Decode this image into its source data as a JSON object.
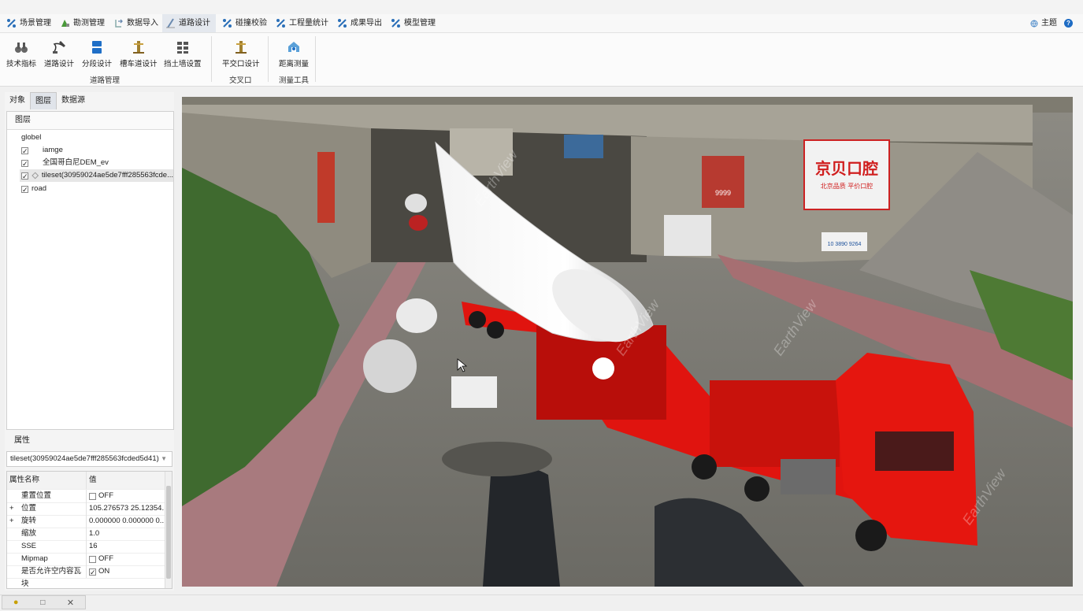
{
  "menu": {
    "items": [
      {
        "label": "场景管理"
      },
      {
        "label": "勘测管理"
      },
      {
        "label": "数据导入"
      },
      {
        "label": "道路设计"
      },
      {
        "label": "碰撞校验"
      },
      {
        "label": "工程量统计"
      },
      {
        "label": "成果导出"
      },
      {
        "label": "模型管理"
      }
    ],
    "theme_label": "主题",
    "help_label": "?"
  },
  "ribbon": {
    "road_group": {
      "label": "道路管理",
      "buttons": [
        {
          "label": "技术指标"
        },
        {
          "label": "道路设计"
        },
        {
          "label": "分段设计"
        },
        {
          "label": "槽车道设计"
        },
        {
          "label": "挡土墙设置"
        }
      ]
    },
    "intersection_group": {
      "label": "交叉口",
      "buttons": [
        {
          "label": "平交口设计"
        }
      ]
    },
    "measure_group": {
      "label": "测量工具",
      "buttons": [
        {
          "label": "距离测量"
        }
      ]
    }
  },
  "left_panel": {
    "tabs": [
      {
        "label": "对象"
      },
      {
        "label": "图层"
      },
      {
        "label": "数据源"
      }
    ],
    "layers": {
      "header": "图层",
      "root": "globel",
      "items": [
        {
          "label": "iamge",
          "checked": true
        },
        {
          "label": "全国哥白尼DEM_ev",
          "checked": true
        },
        {
          "label": "tileset(30959024ae5de7fff285563fcde...",
          "checked": true
        }
      ],
      "road": {
        "label": "road",
        "checked": true
      }
    },
    "properties": {
      "header": "属性",
      "selected_object": "tileset(30959024ae5de7fff285563fcded5d41)",
      "columns": {
        "name": "属性名称",
        "value": "值"
      },
      "rows": [
        {
          "name": "重置位置",
          "value": "OFF",
          "checkbox": true,
          "checked": false,
          "expand": ""
        },
        {
          "name": "位置",
          "value": "105.276573 25.12354...",
          "expand": "+"
        },
        {
          "name": "旋转",
          "value": "0.000000 0.000000 0...",
          "expand": "+"
        },
        {
          "name": "缩放",
          "value": "1.0",
          "expand": ""
        },
        {
          "name": "SSE",
          "value": "16",
          "expand": ""
        },
        {
          "name": "Mipmap",
          "value": "OFF",
          "checkbox": true,
          "checked": false,
          "expand": ""
        },
        {
          "name": "是否允许空内容瓦块",
          "value": "ON",
          "checkbox": true,
          "checked": true,
          "expand": ""
        }
      ]
    }
  },
  "viewport": {
    "billboard_main": "京贝口腔",
    "billboard_small": "北京品质 平价口腔",
    "sign_center": "9999",
    "sign_right": "10 3890 9264",
    "watermark": "EarthView"
  },
  "colors": {
    "accent": "#2a6fb8",
    "truck_red": "#e0140f",
    "menu_active": "#e4e8ee"
  }
}
